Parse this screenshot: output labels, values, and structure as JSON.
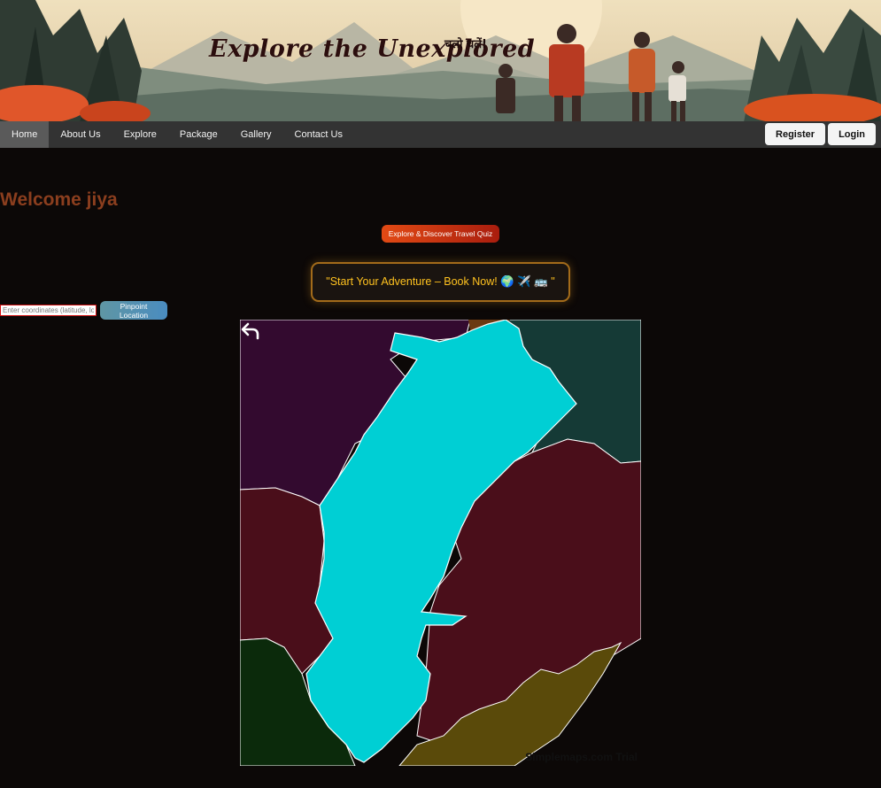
{
  "hero": {
    "title": "Explore the Unexplored",
    "subtitle": "चलो चलें!"
  },
  "nav": {
    "items": [
      "Home",
      "About Us",
      "Explore",
      "Package",
      "Gallery",
      "Contact Us"
    ],
    "active": "Home",
    "register_label": "Register",
    "login_label": "Login"
  },
  "main": {
    "welcome": "Welcome jiya",
    "quiz_button": "Explore & Discover Travel Quiz",
    "book_button": "\"Start Your Adventure – Book Now! 🌍 ✈️ 🚌 \"",
    "coords_placeholder": "Enter coordinates (latitude, longitude)",
    "pinpoint_button": "Pinpoint Location"
  },
  "map": {
    "credit": "Simplemaps.com Trial",
    "back_icon": "back-arrow-icon",
    "colors": {
      "highlight_state": "#00cfd4",
      "north_west_state": "#330a2f",
      "north_east_state": "#153a36",
      "west_state": "#4a0e1a",
      "east_state": "#4a0e1a",
      "south_west_state": "#0b2a0b",
      "south_state": "#5a4a0a",
      "top_sliver": "#6b3a12"
    }
  },
  "colors": {
    "page_bg": "#0c0807",
    "navbar_bg": "#333333",
    "welcome_text": "#8b3e1e",
    "quiz_button": "#e24a14",
    "book_text": "#ffc21f"
  }
}
